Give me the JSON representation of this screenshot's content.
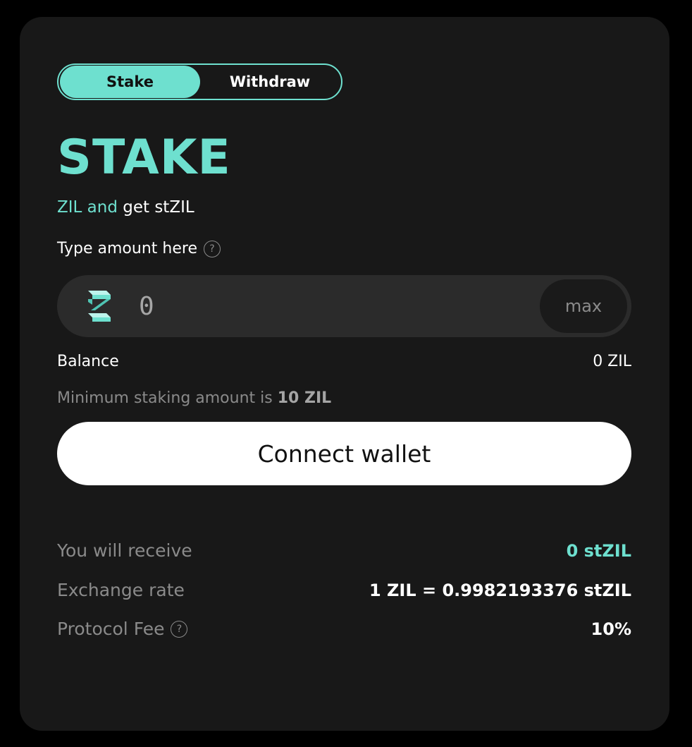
{
  "tabs": [
    {
      "label": "Stake",
      "active": true
    },
    {
      "label": "Withdraw",
      "active": false
    }
  ],
  "title": "STAKE",
  "subtitle": {
    "accent_text": "ZIL and",
    "white_text": "get stZIL"
  },
  "amount_field": {
    "label": "Type amount here",
    "help_icon": "question-circle-icon",
    "placeholder": "0",
    "token_icon": "zilliqa-logo-icon",
    "max_label": "max"
  },
  "balance": {
    "label": "Balance",
    "value": "0 ZIL"
  },
  "min_note": {
    "text": "Minimum staking amount is",
    "amount": "10 ZIL"
  },
  "connect_button": "Connect wallet",
  "info": {
    "receive": {
      "label": "You will receive",
      "value": "0 stZIL"
    },
    "exchange": {
      "label": "Exchange rate",
      "value": "1 ZIL = 0.9982193376 stZIL"
    },
    "fee": {
      "label": "Protocol Fee",
      "value": "10%"
    }
  },
  "colors": {
    "accent": "#6ee0cf",
    "background": "#000000",
    "card": "#181818",
    "input": "#2b2b2b"
  }
}
